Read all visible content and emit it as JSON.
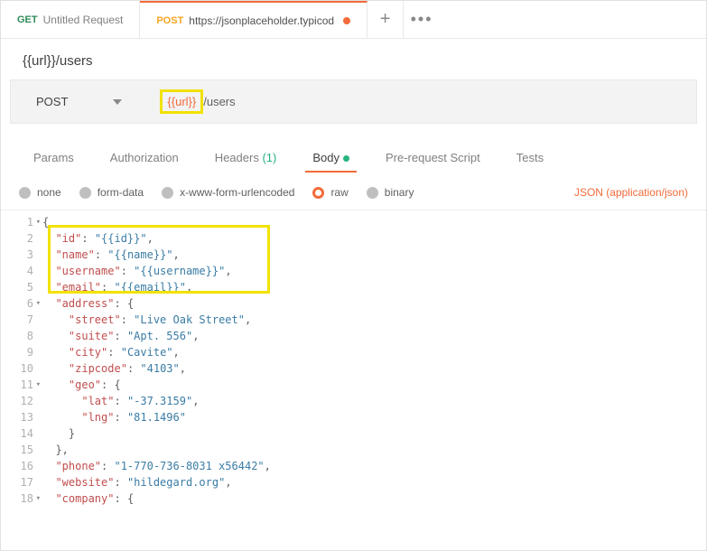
{
  "tabs": {
    "t0": {
      "method": "GET",
      "title": "Untitled Request"
    },
    "t1": {
      "method": "POST",
      "title": "https://jsonplaceholder.typicod"
    },
    "plus": "+",
    "more": "•••"
  },
  "request_name": "{{url}}/users",
  "req_bar": {
    "method": "POST",
    "url_var": "{{url}}",
    "url_rest": "/users"
  },
  "subtabs": {
    "params": "Params",
    "auth": "Authorization",
    "headers": "Headers",
    "headers_count": "(1)",
    "body": "Body",
    "prereq": "Pre-request Script",
    "tests": "Tests"
  },
  "body_opts": {
    "none": "none",
    "form": "form-data",
    "url": "x-www-form-urlencoded",
    "raw": "raw",
    "binary": "binary",
    "json_type": "JSON (application/json)"
  },
  "gutter": [
    "1",
    "2",
    "3",
    "4",
    "5",
    "6",
    "7",
    "8",
    "9",
    "10",
    "11",
    "12",
    "13",
    "14",
    "15",
    "16",
    "17",
    "18"
  ],
  "code": {
    "l1": "{",
    "l2_k": "\"id\"",
    "l2_v": "\"{{id}}\"",
    "l3_k": "\"name\"",
    "l3_v": "\"{{name}}\"",
    "l4_k": "\"username\"",
    "l4_v": "\"{{username}}\"",
    "l5_k": "\"email\"",
    "l5_v": "\"{{email}}\"",
    "l6_k": "\"address\"",
    "l7_k": "\"street\"",
    "l7_v": "\"Live Oak Street\"",
    "l8_k": "\"suite\"",
    "l8_v": "\"Apt. 556\"",
    "l9_k": "\"city\"",
    "l9_v": "\"Cavite\"",
    "l10_k": "\"zipcode\"",
    "l10_v": "\"4103\"",
    "l11_k": "\"geo\"",
    "l12_k": "\"lat\"",
    "l12_v": "\"-37.3159\"",
    "l13_k": "\"lng\"",
    "l13_v": "\"81.1496\"",
    "l14": "    }",
    "l15": "  },",
    "l16_k": "\"phone\"",
    "l16_v": "\"1-770-736-8031 x56442\"",
    "l17_k": "\"website\"",
    "l17_v": "\"hildegard.org\"",
    "l18_k": "\"company\""
  }
}
